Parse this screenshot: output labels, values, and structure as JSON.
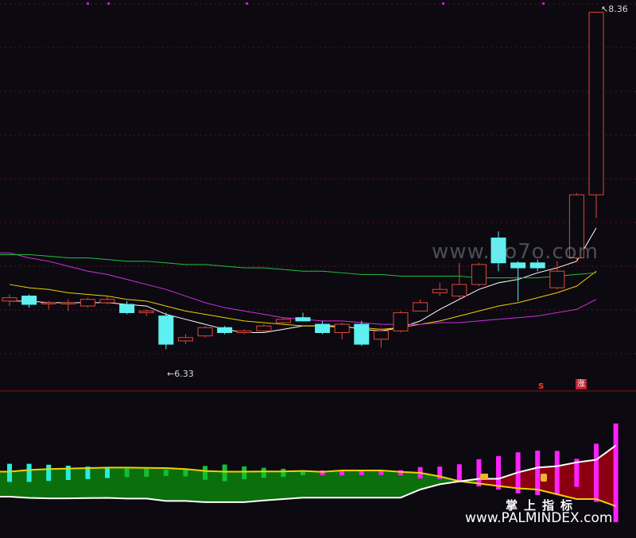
{
  "labels": {
    "high_price": "8.36",
    "low_price": "6.33",
    "watermark": "www.5o7o.com",
    "brand_cn": "掌上指标",
    "brand_url": "www.PALMINDEX.com",
    "signal_s": "s",
    "signal_zhang": "涨"
  },
  "colors": {
    "background": "#0c0a10",
    "up": "#e0463c",
    "down": "#5ef0f0",
    "ma5": "#ffffff",
    "ma10": "#f0d000",
    "ma20": "#d030e0",
    "ma60": "#20c040",
    "band_fill": "#0b6f0b",
    "band_fill_red": "#8a0010",
    "bar_cyan": "#20f0e0",
    "bar_green": "#10c030",
    "bar_magenta": "#ff20ff"
  },
  "chart_data": [
    {
      "type": "candlestick",
      "title": "",
      "xlabel": "",
      "ylabel": "",
      "ylim": [
        6.15,
        8.4
      ],
      "annotations": [
        {
          "text": "8.36",
          "at_index": 30,
          "price": 8.36
        },
        {
          "text": "6.33",
          "at_index": 8,
          "price": 6.33
        }
      ],
      "candles": [
        {
          "o": 6.62,
          "h": 6.66,
          "l": 6.59,
          "c": 6.64
        },
        {
          "o": 6.65,
          "h": 6.66,
          "l": 6.58,
          "c": 6.6
        },
        {
          "o": 6.61,
          "h": 6.62,
          "l": 6.57,
          "c": 6.61
        },
        {
          "o": 6.61,
          "h": 6.63,
          "l": 6.56,
          "c": 6.61
        },
        {
          "o": 6.59,
          "h": 6.64,
          "l": 6.58,
          "c": 6.63
        },
        {
          "o": 6.61,
          "h": 6.65,
          "l": 6.6,
          "c": 6.63
        },
        {
          "o": 6.6,
          "h": 6.62,
          "l": 6.54,
          "c": 6.55
        },
        {
          "o": 6.55,
          "h": 6.57,
          "l": 6.53,
          "c": 6.56
        },
        {
          "o": 6.53,
          "h": 6.55,
          "l": 6.33,
          "c": 6.36
        },
        {
          "o": 6.38,
          "h": 6.42,
          "l": 6.36,
          "c": 6.4
        },
        {
          "o": 6.41,
          "h": 6.47,
          "l": 6.4,
          "c": 6.46
        },
        {
          "o": 6.46,
          "h": 6.47,
          "l": 6.42,
          "c": 6.43
        },
        {
          "o": 6.43,
          "h": 6.45,
          "l": 6.42,
          "c": 6.44
        },
        {
          "o": 6.44,
          "h": 6.48,
          "l": 6.43,
          "c": 6.47
        },
        {
          "o": 6.49,
          "h": 6.52,
          "l": 6.48,
          "c": 6.51
        },
        {
          "o": 6.52,
          "h": 6.55,
          "l": 6.5,
          "c": 6.5
        },
        {
          "o": 6.48,
          "h": 6.5,
          "l": 6.42,
          "c": 6.43
        },
        {
          "o": 6.43,
          "h": 6.49,
          "l": 6.39,
          "c": 6.48
        },
        {
          "o": 6.48,
          "h": 6.5,
          "l": 6.35,
          "c": 6.36
        },
        {
          "o": 6.39,
          "h": 6.46,
          "l": 6.34,
          "c": 6.44
        },
        {
          "o": 6.44,
          "h": 6.56,
          "l": 6.43,
          "c": 6.55
        },
        {
          "o": 6.56,
          "h": 6.63,
          "l": 6.56,
          "c": 6.61
        },
        {
          "o": 6.67,
          "h": 6.73,
          "l": 6.65,
          "c": 6.69
        },
        {
          "o": 6.65,
          "h": 6.85,
          "l": 6.63,
          "c": 6.72
        },
        {
          "o": 6.72,
          "h": 6.85,
          "l": 6.71,
          "c": 6.84
        },
        {
          "o": 7.0,
          "h": 7.04,
          "l": 6.8,
          "c": 6.85
        },
        {
          "o": 6.85,
          "h": 6.86,
          "l": 6.62,
          "c": 6.82
        },
        {
          "o": 6.85,
          "h": 6.87,
          "l": 6.8,
          "c": 6.82
        },
        {
          "o": 6.7,
          "h": 6.86,
          "l": 6.69,
          "c": 6.8
        },
        {
          "o": 6.88,
          "h": 7.27,
          "l": 6.86,
          "c": 7.26
        },
        {
          "o": 7.26,
          "h": 8.36,
          "l": 7.12,
          "c": 8.36
        }
      ],
      "series": [
        {
          "values": [
            6.62,
            6.62,
            6.61,
            6.61,
            6.61,
            6.61,
            6.6,
            6.59,
            6.54,
            6.51,
            6.48,
            6.45,
            6.43,
            6.43,
            6.45,
            6.47,
            6.47,
            6.47,
            6.45,
            6.44,
            6.46,
            6.5,
            6.57,
            6.63,
            6.69,
            6.73,
            6.75,
            6.79,
            6.82,
            6.86,
            7.06
          ]
        },
        {
          "values": [
            6.72,
            6.7,
            6.69,
            6.67,
            6.66,
            6.65,
            6.63,
            6.62,
            6.59,
            6.56,
            6.54,
            6.52,
            6.5,
            6.49,
            6.48,
            6.47,
            6.47,
            6.46,
            6.46,
            6.45,
            6.46,
            6.48,
            6.5,
            6.53,
            6.56,
            6.59,
            6.61,
            6.64,
            6.67,
            6.71,
            6.8
          ]
        },
        {
          "values": [
            6.91,
            6.88,
            6.86,
            6.83,
            6.8,
            6.78,
            6.75,
            6.72,
            6.69,
            6.65,
            6.61,
            6.58,
            6.56,
            6.54,
            6.52,
            6.51,
            6.5,
            6.5,
            6.49,
            6.48,
            6.48,
            6.48,
            6.49,
            6.49,
            6.5,
            6.51,
            6.52,
            6.53,
            6.55,
            6.57,
            6.63
          ]
        },
        {
          "values": [
            6.9,
            6.9,
            6.89,
            6.88,
            6.88,
            6.87,
            6.86,
            6.86,
            6.85,
            6.84,
            6.84,
            6.83,
            6.82,
            6.82,
            6.81,
            6.8,
            6.8,
            6.79,
            6.78,
            6.78,
            6.77,
            6.77,
            6.77,
            6.77,
            6.76,
            6.76,
            6.76,
            6.76,
            6.77,
            6.78,
            6.79
          ]
        }
      ],
      "signals": [
        {
          "index": 27,
          "text": "s"
        },
        {
          "index": 29,
          "text": "涨"
        }
      ]
    },
    {
      "type": "bar",
      "title": "",
      "xlabel": "",
      "ylabel": "",
      "ylim": [
        -1,
        1
      ],
      "values": [
        0.38,
        0.38,
        0.34,
        0.3,
        0.26,
        0.22,
        0.18,
        0.17,
        0.13,
        0.15,
        0.29,
        0.35,
        0.27,
        0.21,
        0.17,
        0.1,
        -0.1,
        -0.11,
        -0.1,
        -0.09,
        -0.11,
        -0.24,
        -0.26,
        -0.36,
        -0.57,
        -0.7,
        -0.86,
        -0.93,
        -0.92,
        -0.59,
        -1.22,
        -2.07
      ],
      "value_colors": [
        "cyan",
        "cyan",
        "cyan",
        "cyan",
        "cyan",
        "cyan",
        "green",
        "green",
        "green",
        "green",
        "green",
        "green",
        "green",
        "green",
        "green",
        "green",
        "magenta",
        "magenta",
        "magenta",
        "magenta",
        "magenta",
        "magenta",
        "magenta",
        "magenta",
        "magenta",
        "magenta",
        "magenta",
        "magenta",
        "magenta",
        "magenta",
        "magenta",
        "magenta"
      ],
      "series": [
        {
          "values": [
            0.05,
            0.12,
            0.16,
            0.18,
            0.2,
            0.22,
            0.22,
            0.21,
            0.2,
            0.16,
            0.08,
            0.05,
            0.05,
            0.06,
            0.06,
            0.08,
            0.04,
            0.1,
            0.1,
            0.1,
            0.04,
            0.0,
            -0.15,
            -0.35,
            -0.45,
            -0.55,
            -0.65,
            -0.7,
            -0.9,
            -1.1,
            -1.1,
            -1.4
          ]
        },
        {
          "values": [
            -1.0,
            -1.05,
            -1.07,
            -1.07,
            -1.06,
            -1.05,
            -1.08,
            -1.08,
            -1.18,
            -1.18,
            -1.23,
            -1.23,
            -1.23,
            -1.16,
            -1.1,
            -1.04,
            -1.04,
            -1.04,
            -1.04,
            -1.04,
            -1.04,
            -0.7,
            -0.48,
            -0.36,
            -0.25,
            -0.25,
            0.02,
            0.22,
            0.28,
            0.44,
            0.55,
            1.15
          ]
        }
      ]
    }
  ]
}
